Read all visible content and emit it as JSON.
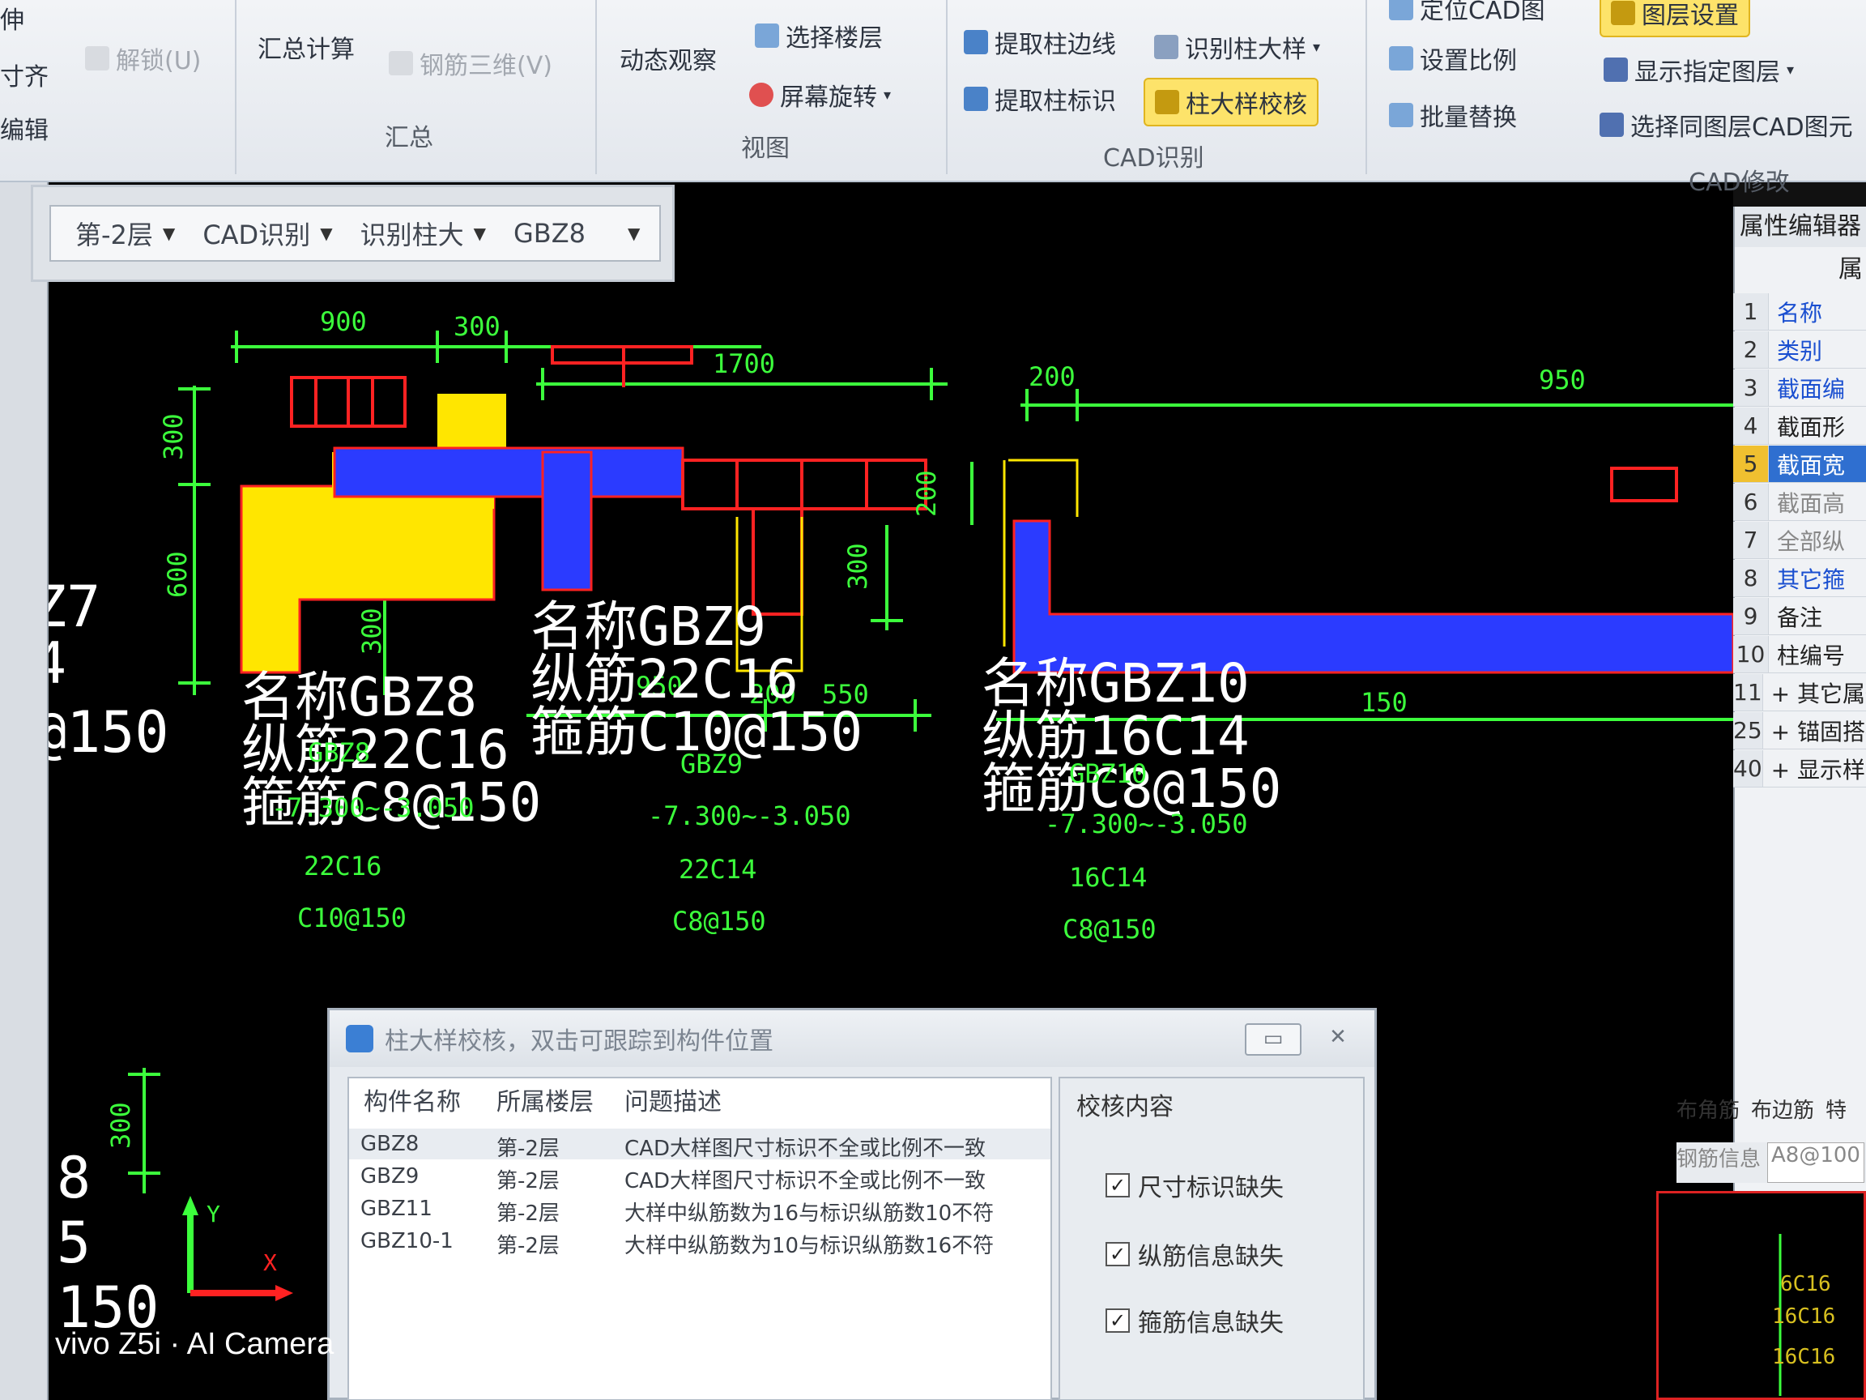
{
  "ribbon": {
    "left_cut": [
      "伸",
      "寸齐",
      "编辑"
    ],
    "unlock": "解锁(U)",
    "sum_calc": "汇总计算",
    "rebar_3d": "钢筋三维(V)",
    "group_summary": "汇总",
    "dynamic_view": "动态观察",
    "select_floor": "选择楼层",
    "screen_rotate": "屏幕旋转",
    "group_view": "视图",
    "extract_col_edge": "提取柱边线",
    "identify_col_detail": "识别柱大样",
    "extract_col_mark": "提取柱标识",
    "col_detail_check": "柱大样校核",
    "group_cad": "CAD识别",
    "locate_cad": "定位CAD图",
    "set_scale": "设置比例",
    "batch_replace": "批量替换",
    "layer_settings": "图层设置",
    "show_layer": "显示指定图层",
    "select_same_layer": "选择同图层CAD图元",
    "group_cad_modify": "CAD修改"
  },
  "toolbar": {
    "floor": "第-2层",
    "mode": "CAD识别",
    "action": "识别柱大",
    "component": "GBZ8"
  },
  "property_editor": {
    "title": "属性编辑器",
    "header": "属",
    "rows": [
      {
        "n": "1",
        "v": "名称",
        "blue": true
      },
      {
        "n": "2",
        "v": "类别",
        "blue": true
      },
      {
        "n": "3",
        "v": "截面编",
        "blue": true
      },
      {
        "n": "4",
        "v": "截面形",
        "blue": false
      },
      {
        "n": "5",
        "v": "截面宽",
        "blue": false,
        "selected": true
      },
      {
        "n": "6",
        "v": "截面高",
        "blue": false,
        "gray": true
      },
      {
        "n": "7",
        "v": "全部纵",
        "blue": false,
        "gray": true
      },
      {
        "n": "8",
        "v": "其它箍",
        "blue": true
      },
      {
        "n": "9",
        "v": "备注",
        "blue": false
      },
      {
        "n": "10",
        "v": "柱编号",
        "blue": false
      },
      {
        "n": "11",
        "v": "+ 其它属性",
        "blue": false
      },
      {
        "n": "25",
        "v": "+ 锚固搭接",
        "blue": false
      },
      {
        "n": "40",
        "v": "+ 显示样式",
        "blue": false
      }
    ],
    "tabs": [
      "布角筋",
      "布边筋",
      "特"
    ],
    "rebar_info_label": "钢筋信息",
    "rebar_info_value": "A8@100"
  },
  "cad": {
    "dims": {
      "d900": "900",
      "d300a": "300",
      "d1700": "1700",
      "d200a": "200",
      "d950": "950",
      "d300v": "300",
      "d600v": "600",
      "d300b": "300",
      "d300c": "300",
      "d200v": "200",
      "d200b": "200",
      "d550": "550",
      "d950b": "950",
      "d150": "150",
      "d300d": "300"
    },
    "gbz8": {
      "name": "名称GBZ8",
      "long": "纵筋22C16",
      "stir": "箍筋C8@150",
      "tag": "GBZ8",
      "elev": "-7.300~-3.050",
      "rebar": "22C16",
      "stirrup": "C10@150"
    },
    "gbz9": {
      "name": "名称GBZ9",
      "long": "纵筋22C16",
      "stir": "箍筋C10@150",
      "tag": "GBZ9",
      "elev": "-7.300~-3.050",
      "rebar": "22C14",
      "stirrup": "C8@150"
    },
    "gbz10": {
      "name": "名称GBZ10",
      "long": "纵筋16C14",
      "stir": "箍筋C8@150",
      "tag": "GBZ10",
      "elev": "-7.300~-3.050",
      "rebar": "16C14",
      "stirrup": "C8@150"
    },
    "left_cut": [
      "Z7",
      "4",
      "@150",
      "8",
      "5",
      "150"
    ],
    "axis_x": "X",
    "axis_y": "Y",
    "mini_labels": [
      "6C16",
      "16C16",
      "16C16"
    ]
  },
  "dialog": {
    "title": "柱大样校核，双击可跟踪到构件位置",
    "columns": [
      "构件名称",
      "所属楼层",
      "问题描述"
    ],
    "rows": [
      [
        "GBZ8",
        "第-2层",
        "CAD大样图尺寸标识不全或比例不一致"
      ],
      [
        "GBZ9",
        "第-2层",
        "CAD大样图尺寸标识不全或比例不一致"
      ],
      [
        "GBZ11",
        "第-2层",
        "大样中纵筋数为16与标识纵筋数10不符"
      ],
      [
        "GBZ10-1",
        "第-2层",
        "大样中纵筋数为10与标识纵筋数16不符"
      ]
    ],
    "check_title": "校核内容",
    "checks": [
      "尺寸标识缺失",
      "纵筋信息缺失",
      "箍筋信息缺失"
    ]
  },
  "watermark": "vivo Z5i · AI Camera",
  "colors": {
    "dim": "#3cff3c",
    "yellow": "#ffe600",
    "blue": "#2b3bff",
    "red": "#ff2222",
    "white": "#ffffff"
  }
}
